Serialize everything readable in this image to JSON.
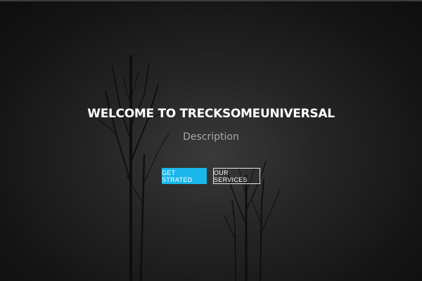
{
  "hero": {
    "title": "WELCOME TO TRECKSOMEUNIVERSAL",
    "description": "Description",
    "primary_button": "GET STRATED",
    "secondary_button": "OUR SERVICES",
    "accent_color": "#1ab7ea",
    "background_color": "#1a1a1a"
  }
}
